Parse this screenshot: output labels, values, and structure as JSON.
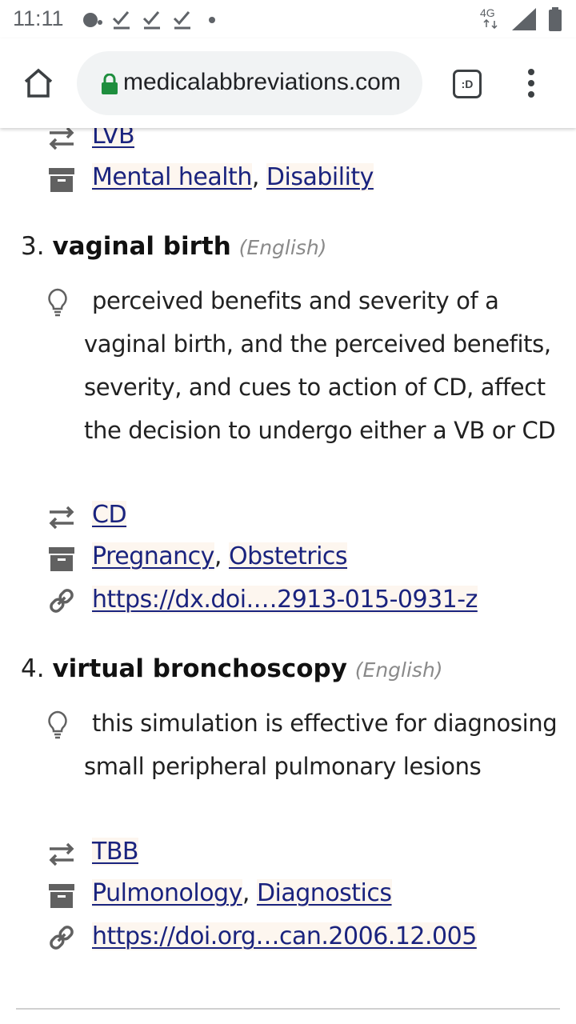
{
  "status_bar": {
    "time": "11:11",
    "network": "4G"
  },
  "browser": {
    "url": "medicalabbreviations.com",
    "tab_count": ":D"
  },
  "entry2": {
    "abbr": "LVB",
    "tags": [
      "Mental health",
      "Disability"
    ]
  },
  "entry3": {
    "number": "3.",
    "term": "vaginal birth",
    "language": "(English)",
    "description": "perceived benefits and severity of a vaginal birth, and the perceived benefits, severity, and cues to action of CD, affect the decision to undergo either a VB or CD",
    "abbr": "CD",
    "tags": [
      "Pregnancy",
      "Obstetrics"
    ],
    "source": "https://dx.doi.…2913-015-0931-z"
  },
  "entry4": {
    "number": "4.",
    "term": "virtual bronchoscopy",
    "language": "(English)",
    "description": "this simulation is effective for diagnosing small peripheral pulmonary lesions",
    "abbr": "TBB",
    "tags": [
      "Pulmonology",
      "Diagnostics"
    ],
    "source": "https://doi.org…can.2006.12.005"
  },
  "icons": {
    "abbreviation": "swap-arrows-icon",
    "category": "archive-box-icon",
    "source": "link-icon",
    "example": "lightbulb-icon"
  },
  "colors": {
    "link": "#1a237e",
    "link_bg": "#fdf6ef",
    "lock": "#1e8e3e"
  }
}
